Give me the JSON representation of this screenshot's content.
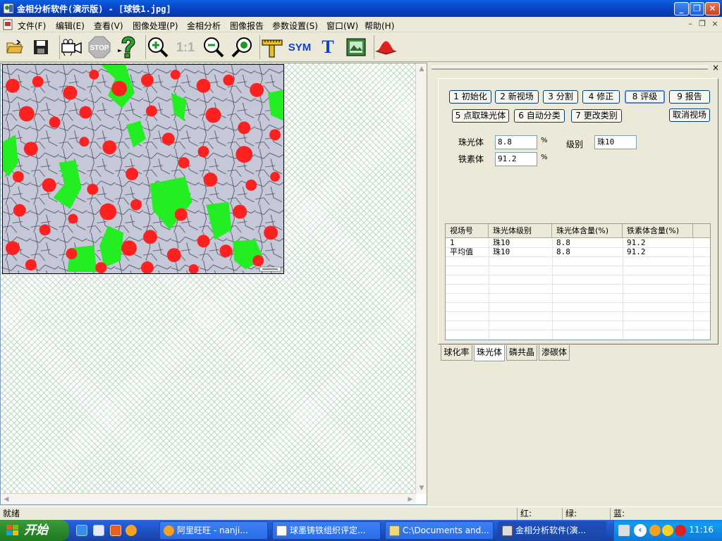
{
  "window": {
    "title": "金相分析软件(演示版) - [球铁1.jpg]",
    "minimize": "_",
    "maximize": "❐",
    "close": "✕"
  },
  "menu": {
    "items": [
      "文件(F)",
      "编辑(E)",
      "查看(V)",
      "图像处理(P)",
      "金相分析",
      "图像报告",
      "参数设置(S)",
      "窗口(W)",
      "帮助(H)"
    ],
    "mdi_min": "–",
    "mdi_restore": "❐",
    "mdi_close": "×"
  },
  "toolbar": {
    "stop_label": "STOP",
    "ratio_label": "1:1",
    "sym_label": "SYM",
    "text_label": "T"
  },
  "panel": {
    "close": "×",
    "buttons_row1": [
      "1 初始化",
      "2 新视场",
      "3 分割",
      "4 修正",
      "8 评级",
      "9 报告"
    ],
    "buttons_row2": [
      "5 点取珠光体",
      "6 自动分类",
      "7 更改类别"
    ],
    "cancel_button": "取消视场",
    "pearlite_label": "珠光体",
    "pearlite_value": "8.8",
    "pearlite_unit": "%",
    "ferrite_label": "铁素体",
    "ferrite_value": "91.2",
    "ferrite_unit": "%",
    "grade_label": "级别",
    "grade_value": "珠10"
  },
  "table": {
    "columns": [
      "视场号",
      "珠光体级别",
      "珠光体含量(%)",
      "铁素体含量(%)"
    ],
    "rows": [
      [
        "1",
        "珠10",
        "8.8",
        "91.2"
      ],
      [
        "平均值",
        "珠10",
        "8.8",
        "91.2"
      ]
    ]
  },
  "tabs": [
    "球化率",
    "珠光体",
    "磷共晶",
    "渗碳体"
  ],
  "status": {
    "ready": "就绪",
    "red": "红:",
    "green": "绿:",
    "blue": "蓝:"
  },
  "taskbar": {
    "start": "开始",
    "tasks": [
      "阿里旺旺 - nanji...",
      "球墨铸铁组织评定...",
      "C:\\Documents and...",
      "金相分析软件(演..."
    ],
    "clock": "11:16"
  },
  "colors": {
    "accent": "#0a3fc0",
    "nodule_red": "#ff2020",
    "pearlite_green": "#22ee22"
  }
}
